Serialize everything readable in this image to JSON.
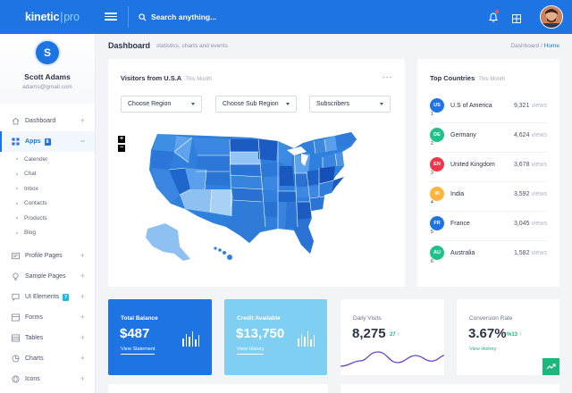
{
  "topbar": {
    "brand": "kinetic",
    "brand_suffix": "pro",
    "search_placeholder": "Search anything..."
  },
  "sidebar": {
    "user_initial": "S",
    "user_name": "Scott Adams",
    "user_email": "adams@gmail.com",
    "items": [
      {
        "label": "Dashboard",
        "icon": "home-icon"
      },
      {
        "label": "Apps",
        "icon": "apps-grid-icon",
        "badge": "8"
      },
      {
        "label": "Profile Pages",
        "icon": "profile-card-icon"
      },
      {
        "label": "Sample Pages",
        "icon": "lightbulb-icon"
      },
      {
        "label": "UI Elements",
        "icon": "chat-bubble-icon",
        "badge": "7"
      },
      {
        "label": "Forms",
        "icon": "form-icon"
      },
      {
        "label": "Tables",
        "icon": "table-icon"
      },
      {
        "label": "Charts",
        "icon": "pie-chart-icon"
      },
      {
        "label": "Icons",
        "icon": "globe-icon"
      }
    ],
    "apps_sub": [
      "Calender",
      "Chat",
      "Inbox",
      "Contacts",
      "Products",
      "Blog"
    ]
  },
  "header": {
    "title": "Dashboard",
    "subtitle": "statistics, charts and events",
    "breadcrumb": [
      "Dashboard",
      "Home"
    ],
    "breadcrumb_sep": "/"
  },
  "map_card": {
    "title": "Visitors from U.S.A",
    "period": "This Month",
    "selects": [
      "Choose Region",
      "Choose Sub Region",
      "Subscribers"
    ]
  },
  "countries_card": {
    "title": "Top Countries",
    "period": "This Month",
    "views_label": "views",
    "rows": [
      {
        "code": "US",
        "rank": "1",
        "name": "U.S of America",
        "views": "9,321",
        "color": "#1e74e2"
      },
      {
        "code": "DE",
        "rank": "2",
        "name": "Germany",
        "views": "4,624",
        "color": "#1fc28b"
      },
      {
        "code": "EN",
        "rank": "3",
        "name": "United Kingdom",
        "views": "3,678",
        "color": "#f0364a"
      },
      {
        "code": "IN",
        "rank": "4",
        "name": "India",
        "views": "3,592",
        "color": "#ffb43c"
      },
      {
        "code": "FR",
        "rank": "5",
        "name": "France",
        "views": "3,045",
        "color": "#1e74e2"
      },
      {
        "code": "AU",
        "rank": "6",
        "name": "Australia",
        "views": "1,582",
        "color": "#1fc28b"
      }
    ]
  },
  "stats": {
    "total_balance": {
      "label": "Total Balance",
      "value": "$487",
      "link": "View Statement"
    },
    "credit": {
      "label": "Credit Available",
      "value": "$13,750",
      "link": "View History"
    },
    "daily_visits": {
      "label": "Daily Visits",
      "value": "8,275",
      "delta": "27"
    },
    "conversion": {
      "label": "Conversion Rate",
      "value": "3.67%",
      "delta": "%13",
      "link": "View History"
    }
  },
  "colors": {
    "primary": "#1e74e2",
    "light_blue": "#7ecff1",
    "success": "#1fb57c"
  }
}
